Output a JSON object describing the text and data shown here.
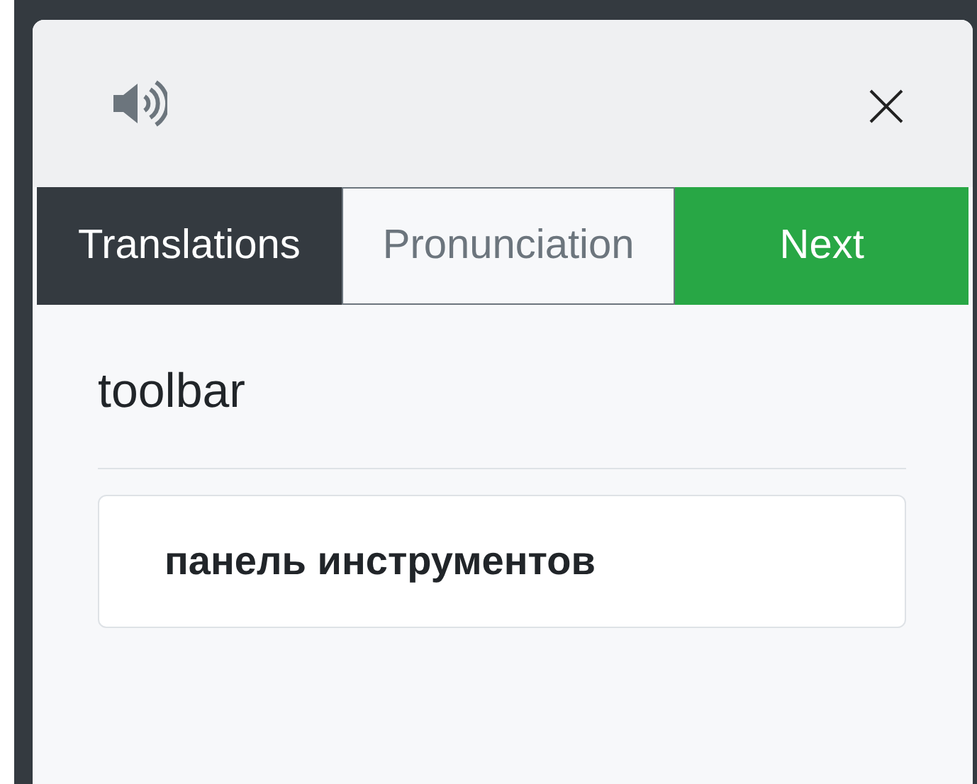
{
  "tabs": [
    {
      "label": "Translations",
      "selected": true
    },
    {
      "label": "Pronunciation",
      "selected": false
    }
  ],
  "next_button": {
    "label": "Next"
  },
  "word": "toolbar",
  "translations": [
    "панель инструментов"
  ]
}
